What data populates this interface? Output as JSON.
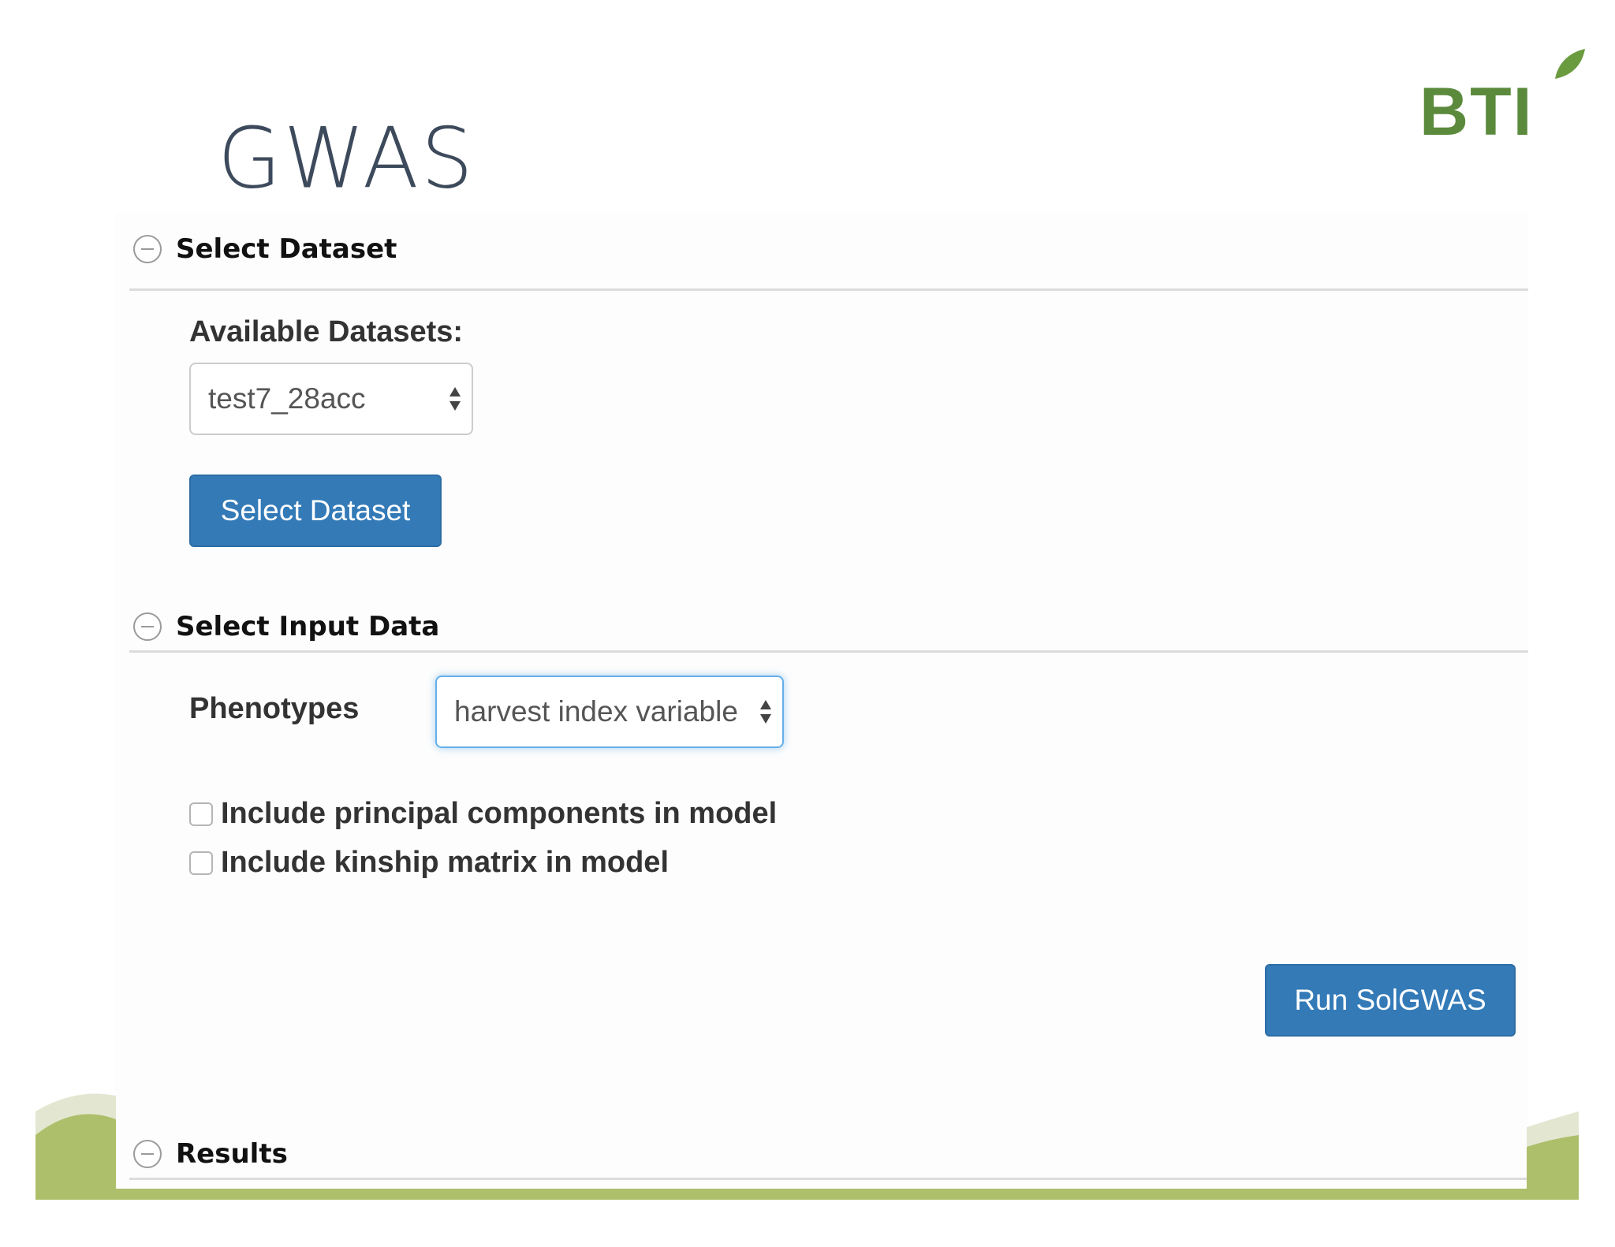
{
  "slide": {
    "title": "GWAS",
    "logo_text": "BTI"
  },
  "sections": {
    "select_dataset": {
      "title": "Select Dataset",
      "available_label": "Available Datasets:",
      "dataset_selected": "test7_28acc",
      "button_label": "Select Dataset"
    },
    "select_input": {
      "title": "Select Input Data",
      "phenotypes_label": "Phenotypes",
      "phenotype_selected": "harvest index variable",
      "checkboxes": [
        {
          "label": "Include principal components in model",
          "checked": false
        },
        {
          "label": "Include kinship matrix in model",
          "checked": false
        }
      ],
      "run_label": "Run SolGWAS"
    },
    "results": {
      "title": "Results"
    }
  },
  "colors": {
    "primary": "#337ab7",
    "logo_green": "#5b8a3c",
    "footer_green": "#aebf6b"
  },
  "icons": {
    "collapse": "minus-circle-icon",
    "select": "sort-arrows-icon"
  }
}
